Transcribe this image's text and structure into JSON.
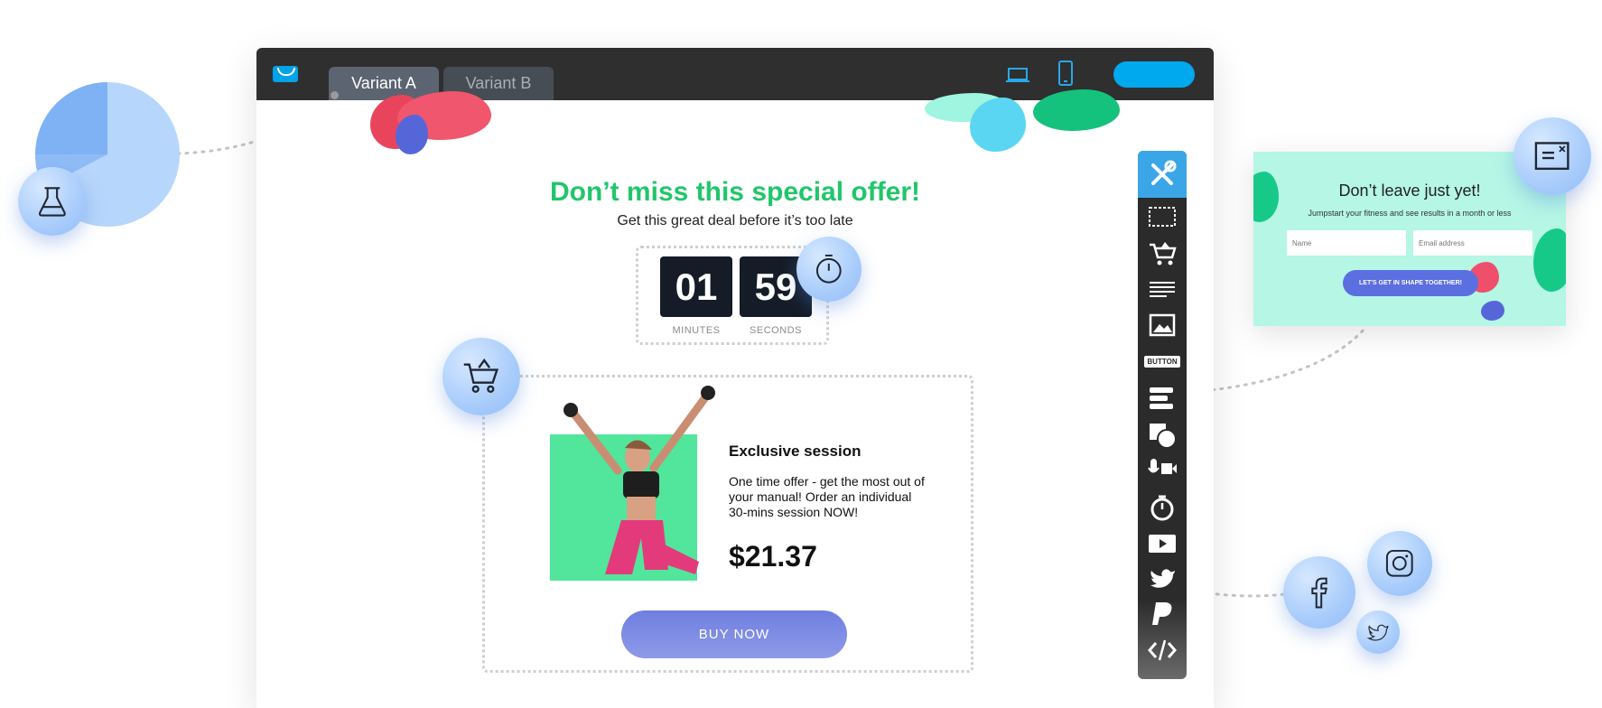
{
  "editor": {
    "tabs": [
      {
        "label": "Variant A",
        "active": true
      },
      {
        "label": "Variant B",
        "active": false
      }
    ],
    "devices": [
      "laptop-icon",
      "phone-icon"
    ],
    "publish_button_color": "#00a9ee"
  },
  "canvas": {
    "headline": "Don’t miss this special offer!",
    "headline_color": "#21c66b",
    "subline": "Get this great deal before it’s too late",
    "timer": {
      "minutes": "01",
      "seconds": "59",
      "minutes_label": "MINUTES",
      "seconds_label": "SECONDS"
    },
    "product": {
      "title": "Exclusive session",
      "description": "One time offer - get the most out of your manual! Order an individual 30-mins session NOW!",
      "price": "$21.37",
      "button_label": "BUY NOW",
      "image_bg": "#52e59c"
    }
  },
  "toolbar": {
    "items": [
      "tools-icon",
      "section-icon",
      "cart-icon",
      "text-icon",
      "image-icon",
      "button-icon",
      "form-icon",
      "shapes-icon",
      "media-icon",
      "timer-icon",
      "video-icon",
      "twitter-icon",
      "paypal-icon",
      "code-icon"
    ],
    "button_label": "BUTTON",
    "accent": "#3aa6e8"
  },
  "popup": {
    "title": "Don’t leave just yet!",
    "subtitle": "Jumpstart your fitness and see results in a month or less",
    "name_placeholder": "Name",
    "email_placeholder": "Email address",
    "button_label": "LET'S GET IN SHAPE TOGETHER!"
  },
  "bubbles": [
    "flask-icon",
    "timer-icon",
    "cart-icon",
    "popup-icon",
    "facebook-icon",
    "instagram-icon",
    "twitter-icon"
  ]
}
